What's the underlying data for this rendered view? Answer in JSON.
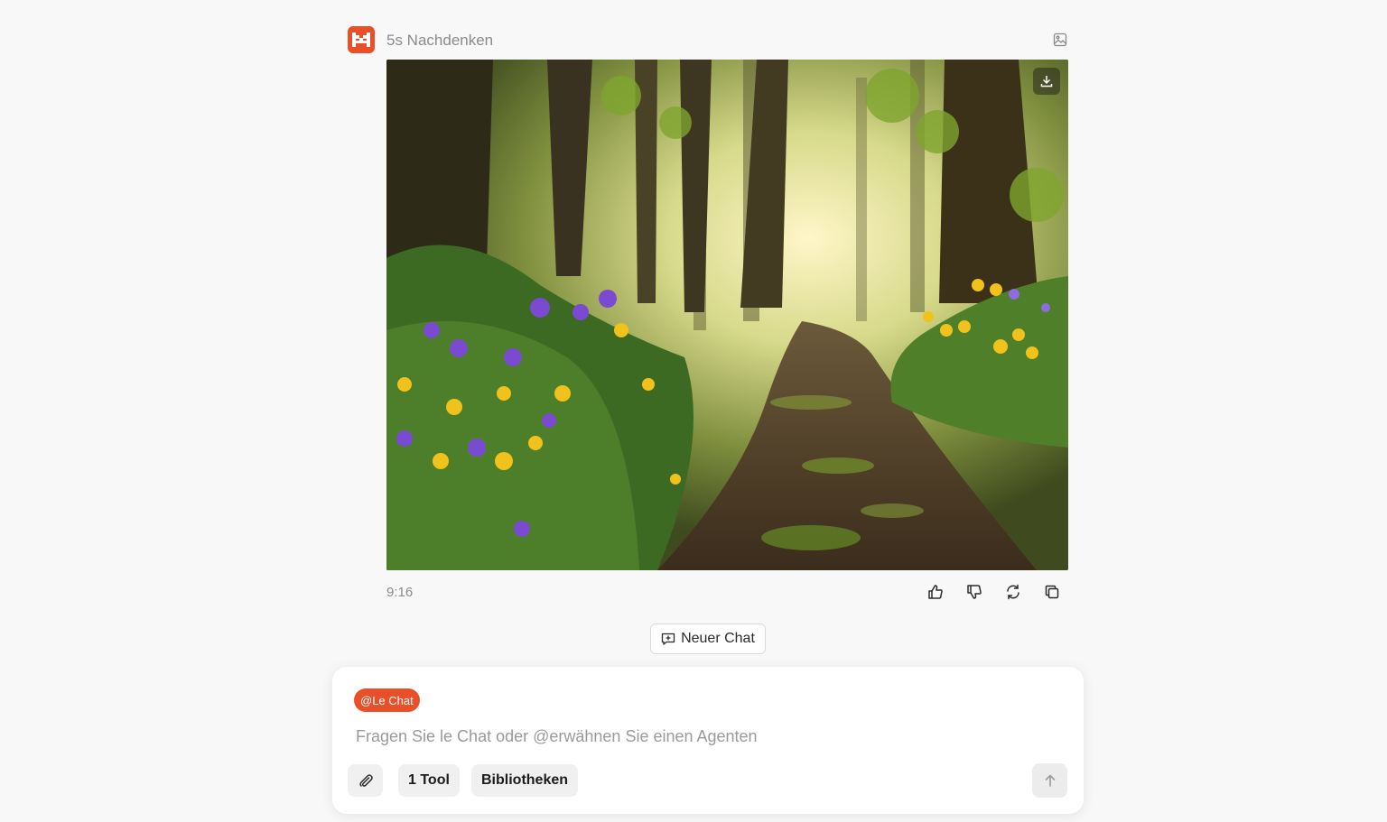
{
  "message": {
    "thinking_label": "5s Nachdenken",
    "timestamp": "9:16",
    "image_alt": "Waldweg mit Blumen"
  },
  "actions": {
    "like": "thumbs-up-icon",
    "dislike": "thumbs-down-icon",
    "regenerate": "refresh-icon",
    "copy": "copy-icon"
  },
  "new_chat": {
    "label": "Neuer Chat"
  },
  "composer": {
    "agent_chip": "@Le Chat",
    "placeholder": "Fragen Sie le Chat oder @erwähnen Sie einen Agenten",
    "value": "",
    "tools_label": "1 Tool",
    "libraries_label": "Bibliotheken"
  },
  "colors": {
    "accent": "#e8502a",
    "background": "#f8f8f8",
    "muted_text": "#8a8a8a"
  }
}
